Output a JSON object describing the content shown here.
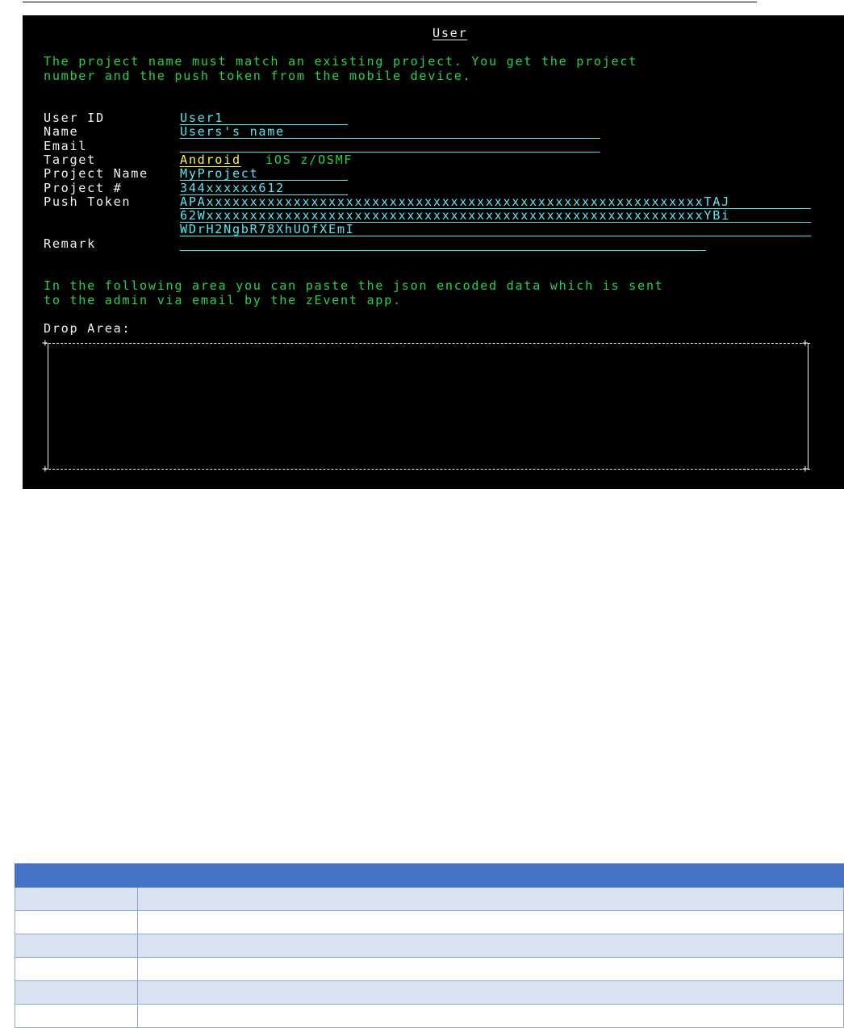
{
  "screen": {
    "title": "User",
    "intro_line1": "The project name must match an existing project. You get the project",
    "intro_line2": "number and the push token from the mobile device.",
    "labels": {
      "user_id": "User ID",
      "name": "Name",
      "email": "Email",
      "target": "Target",
      "project_name": "Project Name",
      "project_number": "Project #",
      "push_token": "Push Token",
      "remark": "Remark"
    },
    "values": {
      "user_id": "User1",
      "name": "Users's name",
      "email": "",
      "project_name": "MyProject",
      "project_number": "344xxxxxx612",
      "push_token_line1": "APAxxxxxxxxxxxxxxxxxxxxxxxxxxxxxxxxxxxxxxxxxxxxxxxxxxxxxxxxxTAJ",
      "push_token_line2": "62WxxxxxxxxxxxxxxxxxxxxxxxxxxxxxxxxxxxxxxxxxxxxxxxxxxxxxxxxxYBi",
      "push_token_line3": "WDrH2NgbR78XhUOfXEmI",
      "remark": ""
    },
    "target_options": {
      "selected": "Android",
      "others": "iOS z/OSMF"
    },
    "drop_text_line1": "In the following area you can paste the json encoded data which is sent",
    "drop_text_line2": "to the admin via email by the zEvent app.",
    "drop_label": "Drop Area:"
  },
  "colors": {
    "terminal_bg": "#000000",
    "green": "#22d24a",
    "white": "#f2f2f2",
    "cyan": "#54e6ee",
    "yellow": "#fff23a",
    "table_header": "#4472c4",
    "table_band": "#d9e1f2"
  }
}
